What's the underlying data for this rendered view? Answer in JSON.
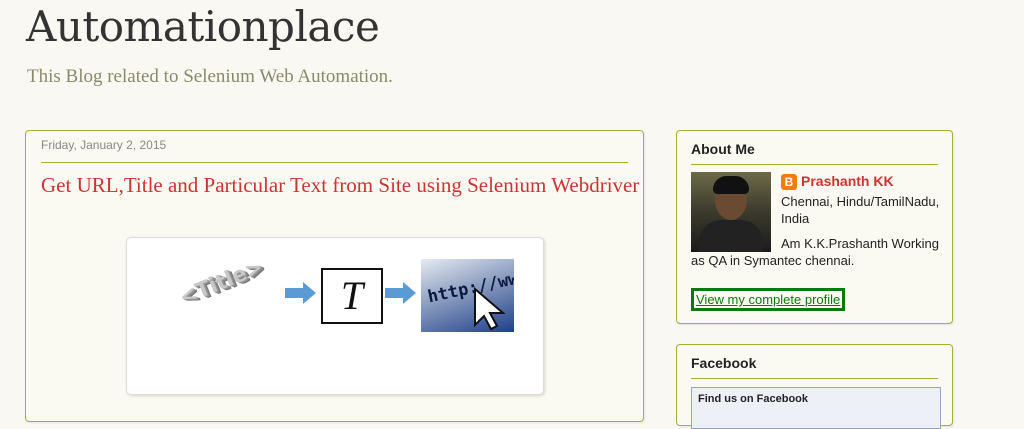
{
  "header": {
    "blog_title": "Automationplace",
    "description": "This Blog related to Selenium Web Automation."
  },
  "post": {
    "date": "Friday, January 2, 2015",
    "title": "Get URL,Title and Particular Text from Site using Selenium Webdriver",
    "image": {
      "title_word": "<Title>",
      "text_icon_glyph": "T",
      "http_text": "http://www"
    }
  },
  "sidebar": {
    "about": {
      "heading": "About Me",
      "name": "Prashanth KK",
      "location": "Chennai, Hindu/TamilNadu, India",
      "bio": "Am K.K.Prashanth Working as QA in Symantec chennai.",
      "view_profile": "View my complete profile"
    },
    "facebook": {
      "heading": "Facebook",
      "find_us": "Find us on Facebook"
    }
  },
  "colors": {
    "accent_border": "#9fb33a",
    "link_red": "#cc3333",
    "profile_highlight": "#0a7a0a"
  }
}
